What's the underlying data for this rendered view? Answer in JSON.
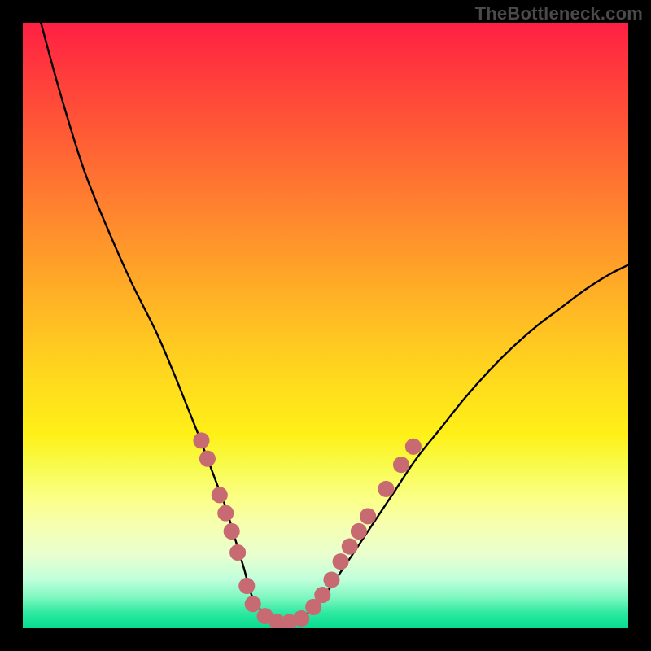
{
  "watermark": "TheBottleneck.com",
  "chart_data": {
    "type": "line",
    "title": "",
    "xlabel": "",
    "ylabel": "",
    "xlim": [
      0,
      100
    ],
    "ylim": [
      0,
      100
    ],
    "series": [
      {
        "name": "curve",
        "x": [
          3,
          6,
          10,
          14,
          18,
          22,
          25,
          27,
          29,
          30.5,
          32,
          33.5,
          35,
          36.5,
          38,
          40.5,
          43,
          46,
          49.5,
          53,
          57,
          61,
          65,
          69,
          73,
          77,
          81,
          85,
          89,
          93,
          97,
          100
        ],
        "y": [
          100,
          89,
          76,
          66,
          57,
          49,
          42,
          37,
          32,
          28,
          24,
          20,
          15,
          10,
          5,
          1.8,
          0.8,
          1.6,
          5,
          10,
          16,
          22,
          28,
          33,
          38,
          42.5,
          46.5,
          50,
          53,
          56,
          58.5,
          60
        ]
      }
    ],
    "markers": {
      "name": "data-points",
      "color": "#c86a71",
      "radius_pct": 1.35,
      "points": [
        {
          "x": 29.5,
          "y": 31
        },
        {
          "x": 30.5,
          "y": 28
        },
        {
          "x": 32.5,
          "y": 22
        },
        {
          "x": 33.5,
          "y": 19
        },
        {
          "x": 34.5,
          "y": 16
        },
        {
          "x": 35.5,
          "y": 12.5
        },
        {
          "x": 37,
          "y": 7
        },
        {
          "x": 38,
          "y": 4
        },
        {
          "x": 40,
          "y": 2
        },
        {
          "x": 42,
          "y": 1
        },
        {
          "x": 44,
          "y": 1
        },
        {
          "x": 46,
          "y": 1.6
        },
        {
          "x": 48,
          "y": 3.5
        },
        {
          "x": 49.5,
          "y": 5.5
        },
        {
          "x": 51,
          "y": 8
        },
        {
          "x": 52.5,
          "y": 11
        },
        {
          "x": 54,
          "y": 13.5
        },
        {
          "x": 55.5,
          "y": 16
        },
        {
          "x": 57,
          "y": 18.5
        },
        {
          "x": 60,
          "y": 23
        },
        {
          "x": 62.5,
          "y": 27
        },
        {
          "x": 64.5,
          "y": 30
        }
      ]
    },
    "gradient_stops": [
      {
        "pct": 0,
        "color": "#ff1f44"
      },
      {
        "pct": 50,
        "color": "#ffd71e"
      },
      {
        "pct": 78,
        "color": "#fbff81"
      },
      {
        "pct": 100,
        "color": "#06dd8f"
      }
    ]
  }
}
